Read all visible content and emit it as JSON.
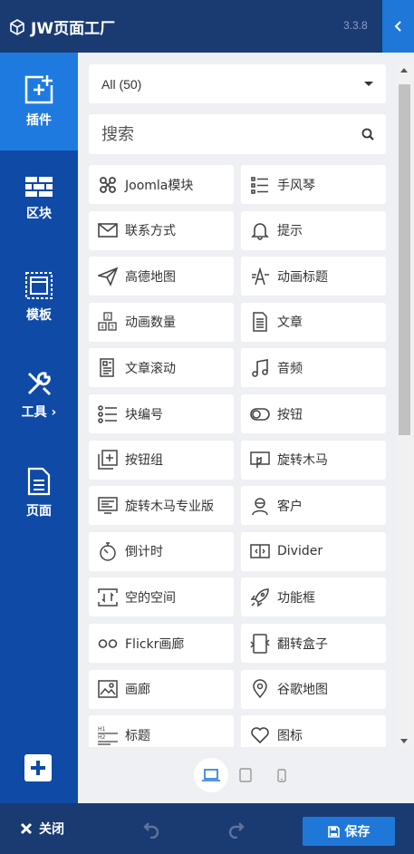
{
  "app": {
    "title": "JW页面工厂",
    "version": "3.3.8"
  },
  "sidebar": {
    "items": [
      {
        "label": "插件",
        "icon": "add-square-icon",
        "active": true
      },
      {
        "label": "区块",
        "icon": "bricks-icon"
      },
      {
        "label": "模板",
        "icon": "template-icon"
      },
      {
        "label": "工具 ›",
        "icon": "tools-icon"
      },
      {
        "label": "页面",
        "icon": "page-icon"
      }
    ],
    "add_icon": "plus-square-icon"
  },
  "filter": {
    "selected": "All (50)"
  },
  "search": {
    "placeholder": "搜索"
  },
  "addons": [
    {
      "label": "Joomla模块",
      "icon": "joomla-icon"
    },
    {
      "label": "手风琴",
      "icon": "list-icon"
    },
    {
      "label": "联系方式",
      "icon": "envelope-icon"
    },
    {
      "label": "提示",
      "icon": "bell-icon"
    },
    {
      "label": "高德地图",
      "icon": "paper-plane-icon"
    },
    {
      "label": "动画标题",
      "icon": "animated-text-icon"
    },
    {
      "label": "动画数量",
      "icon": "number-blocks-icon"
    },
    {
      "label": "文章",
      "icon": "document-icon"
    },
    {
      "label": "文章滚动",
      "icon": "article-scroll-icon"
    },
    {
      "label": "音频",
      "icon": "music-icon"
    },
    {
      "label": "块编号",
      "icon": "numbered-list-icon"
    },
    {
      "label": "按钮",
      "icon": "toggle-icon"
    },
    {
      "label": "按钮组",
      "icon": "button-group-icon"
    },
    {
      "label": "旋转木马",
      "icon": "carousel-icon"
    },
    {
      "label": "旋转木马专业版",
      "icon": "carousel-pro-icon"
    },
    {
      "label": "客户",
      "icon": "clients-icon"
    },
    {
      "label": "倒计时",
      "icon": "stopwatch-icon"
    },
    {
      "label": "Divider",
      "icon": "divider-icon"
    },
    {
      "label": "空的空间",
      "icon": "empty-space-icon"
    },
    {
      "label": "功能框",
      "icon": "rocket-icon"
    },
    {
      "label": "Flickr画廊",
      "icon": "flickr-icon"
    },
    {
      "label": "翻转盒子",
      "icon": "flip-box-icon"
    },
    {
      "label": "画廊",
      "icon": "image-icon"
    },
    {
      "label": "谷歌地图",
      "icon": "map-pin-icon"
    },
    {
      "label": "标题",
      "icon": "heading-icon"
    },
    {
      "label": "图标",
      "icon": "heart-icon"
    }
  ],
  "devices": [
    {
      "name": "desktop",
      "icon": "laptop-icon",
      "active": true
    },
    {
      "name": "tablet",
      "icon": "tablet-icon"
    },
    {
      "name": "mobile",
      "icon": "phone-icon"
    }
  ],
  "bottom": {
    "close_label": "关闭",
    "save_label": "保存"
  },
  "colors": {
    "topbar": "#1a3a72",
    "sidebar": "#0f4aa6",
    "accent": "#1f77d8"
  }
}
